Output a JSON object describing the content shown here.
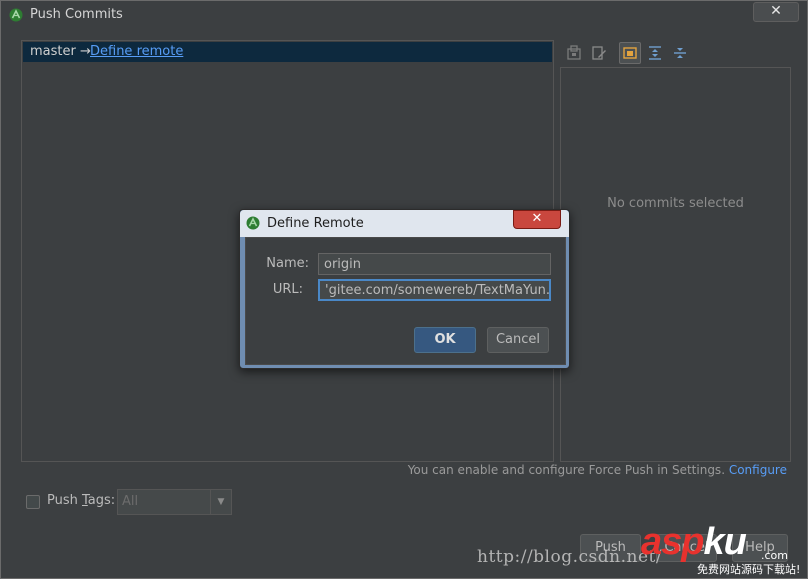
{
  "window": {
    "title": "Push Commits",
    "close_glyph": "✕",
    "icon": "android-studio-icon"
  },
  "left_panel": {
    "branch": "master →",
    "define_remote_link": "Define remote"
  },
  "toolbar": {
    "icons": [
      "repository-icon",
      "edit-source-icon",
      "preview-details-icon",
      "expand-all-icon",
      "collapse-all-icon"
    ]
  },
  "right_panel": {
    "empty_text": "No commits selected"
  },
  "force_push_hint": {
    "text": "You can enable and configure Force Push in Settings. ",
    "link": "Configure"
  },
  "push_tags": {
    "label_pre": "Push ",
    "label_mnemonic": "T",
    "label_post": "ags:",
    "checked": false,
    "select_value": "All"
  },
  "buttons": {
    "push": "Push",
    "cancel": "Cancel",
    "help": "Help"
  },
  "dialog": {
    "title": "Define Remote",
    "close_glyph": "✕",
    "name_label": "Name:",
    "name_value": "origin",
    "url_label": "URL:",
    "url_value": "'gitee.com/somewereb/TextMaYun.git",
    "ok": "OK",
    "cancel": "Cancel"
  },
  "watermark": {
    "url": "http://blog.csdn.net/",
    "logo_main_red": "asp",
    "logo_main_white": "ku",
    "logo_dotcom": ".com",
    "logo_tagline": "免费网站源码下载站!"
  },
  "colors": {
    "background": "#3c3f41",
    "selection": "#0d293e",
    "link": "#589df6",
    "dialog_frame": "#6f8db1",
    "ok_button": "#365880",
    "close_red": "#c9473e"
  }
}
